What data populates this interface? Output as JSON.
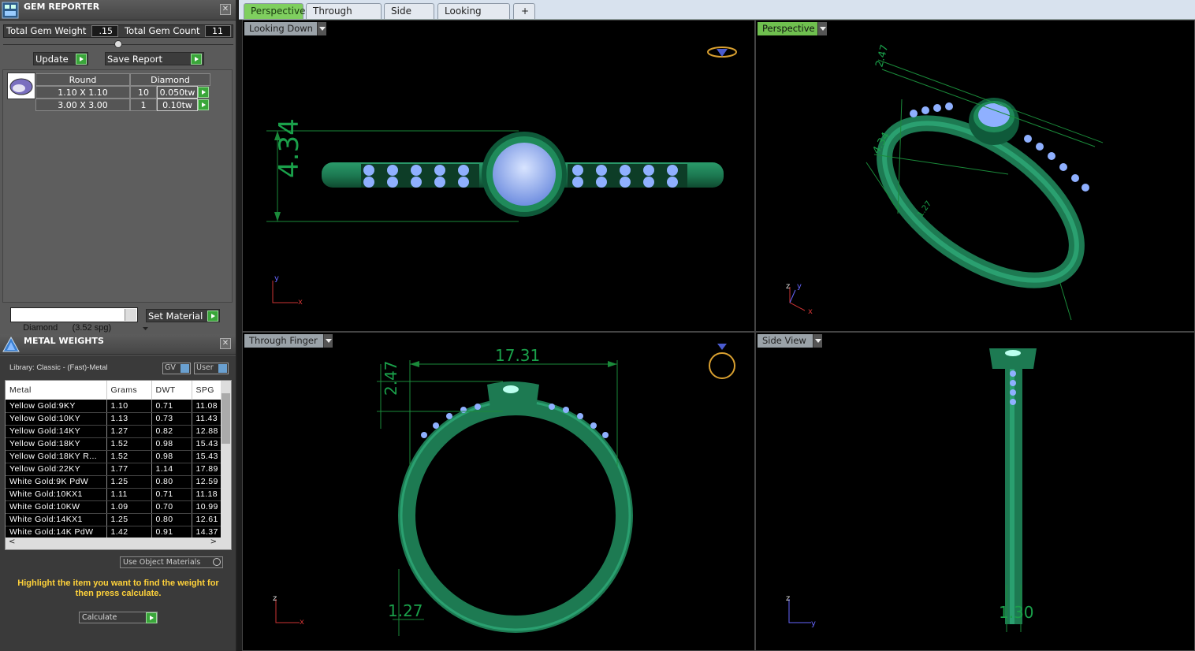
{
  "gem_reporter": {
    "title": "GEM REPORTER",
    "total_weight_label": "Total Gem Weight",
    "total_weight_value": ".15",
    "total_count_label": "Total Gem Count",
    "total_count_value": "11",
    "update_label": "Update",
    "save_label": "Save Report",
    "shape_header": "Round",
    "material_header": "Diamond",
    "rows": [
      {
        "size": "1.10 X 1.10",
        "count": "10",
        "tw": "0.050tw"
      },
      {
        "size": "3.00 X 3.00",
        "count": "1",
        "tw": "0.10tw"
      }
    ],
    "material_select": "Diamond      (3.52 spg)",
    "set_material_label": "Set Material"
  },
  "metal_weights": {
    "title": "METAL WEIGHTS",
    "library": "Library: Classic - (Fast)-Metal",
    "gv_label": "GV",
    "user_label": "User",
    "columns": [
      "Metal",
      "Grams",
      "DWT",
      "SPG"
    ],
    "rows": [
      [
        "Yellow Gold:9KY",
        "1.10",
        "0.71",
        "11.08"
      ],
      [
        "Yellow Gold:10KY",
        "1.13",
        "0.73",
        "11.43"
      ],
      [
        "Yellow Gold:14KY",
        "1.27",
        "0.82",
        "12.88"
      ],
      [
        "Yellow Gold:18KY",
        "1.52",
        "0.98",
        "15.43"
      ],
      [
        "Yellow Gold:18KY R...",
        "1.52",
        "0.98",
        "15.43"
      ],
      [
        "Yellow Gold:22KY",
        "1.77",
        "1.14",
        "17.89"
      ],
      [
        "White Gold:9K PdW",
        "1.25",
        "0.80",
        "12.59"
      ],
      [
        "White Gold:10KX1",
        "1.11",
        "0.71",
        "11.18"
      ],
      [
        "White Gold:10KW",
        "1.09",
        "0.70",
        "10.99"
      ],
      [
        "White Gold:14KX1",
        "1.25",
        "0.80",
        "12.61"
      ],
      [
        "White Gold:14K PdW",
        "1.42",
        "0.91",
        "14.37"
      ]
    ],
    "use_object_label": "Use Object Materials",
    "hint": "Highlight the item you want to find the weight for then press calculate.",
    "calculate_label": "Calculate"
  },
  "tabs": [
    "Perspective",
    "Through Finger",
    "Side View",
    "Looking Down"
  ],
  "viewports": {
    "looking_down": {
      "label": "Looking Down",
      "dim": "4.34"
    },
    "perspective": {
      "label": "Perspective",
      "dim_a": "2.47",
      "dim_b": "4.34",
      "dim_c": "1.27"
    },
    "through_finger": {
      "label": "Through Finger",
      "dim_w": "17.31",
      "dim_h": "2.47",
      "dim_b": "1.27"
    },
    "side_view": {
      "label": "Side View",
      "dim": "1.30"
    }
  },
  "colors": {
    "accent_green": "#3aa63a",
    "ring": "#1f8a5a",
    "gem": "#9fb8ff",
    "hint": "#ffd23a"
  }
}
